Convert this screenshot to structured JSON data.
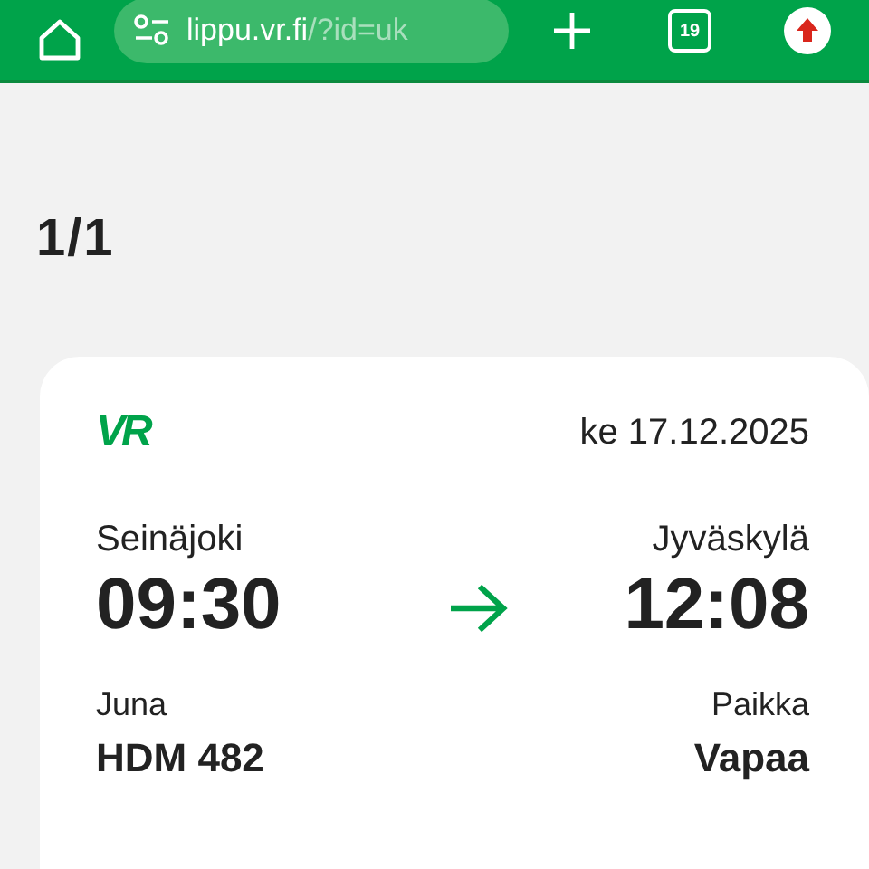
{
  "browser_bar": {
    "url_host": "lippu.vr.fi",
    "url_path": "/?id=uk",
    "tab_count": "19"
  },
  "page_counter": "1/1",
  "ticket": {
    "logo": "VR",
    "date": "ke 17.12.2025",
    "from": {
      "station": "Seinäjoki",
      "time": "09:30"
    },
    "to": {
      "station": "Jyväskylä",
      "time": "12:08"
    },
    "details": [
      {
        "label": "Juna",
        "value": "HDM 482"
      },
      {
        "label": "Paikka",
        "value": "Vapaa"
      }
    ]
  }
}
